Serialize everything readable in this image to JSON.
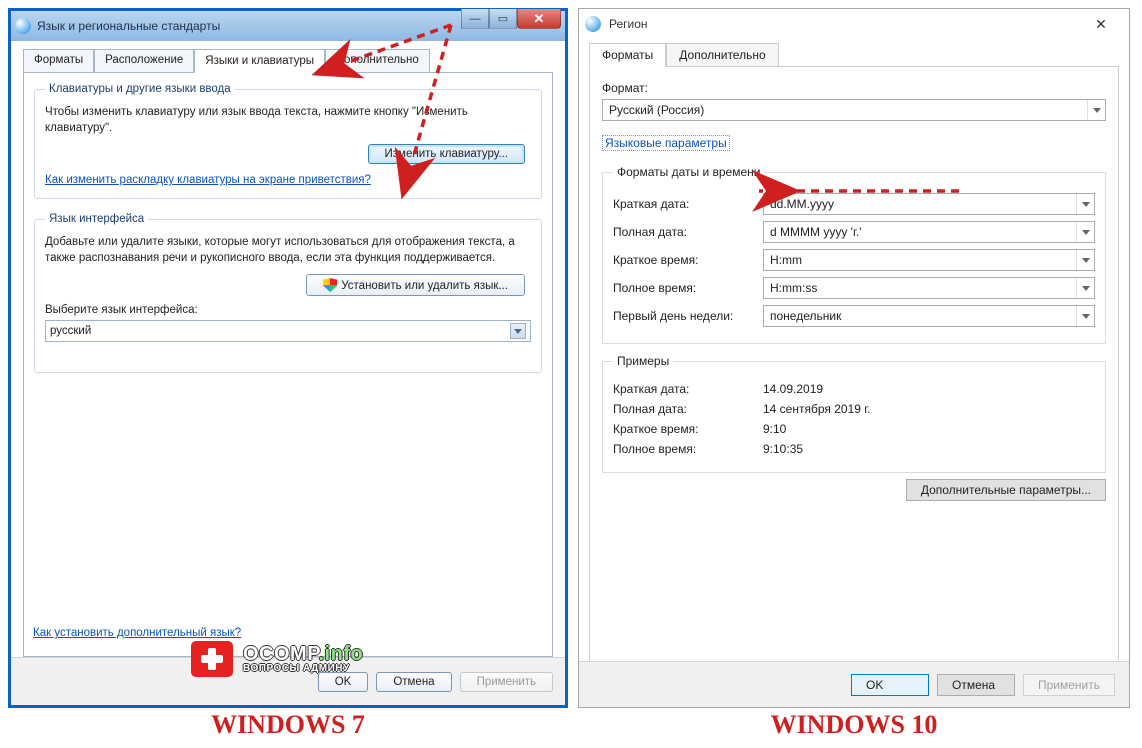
{
  "watermark": {
    "line1a": "OCOMP",
    "line1b": ".info",
    "line2": "ВОПРОСЫ АДМИНУ"
  },
  "captions": {
    "w7": "WINDOWS 7",
    "w10": "WINDOWS 10"
  },
  "w7": {
    "title": "Язык и региональные стандарты",
    "tabs": [
      "Форматы",
      "Расположение",
      "Языки и клавиатуры",
      "Дополнительно"
    ],
    "active_tab": 2,
    "group_keyboards": {
      "legend": "Клавиатуры и другие языки ввода",
      "text": "Чтобы изменить клавиатуру или язык ввода текста, нажмите кнопку \"Изменить клавиатуру\".",
      "button": "Изменить клавиатуру...",
      "link": "Как изменить раскладку клавиатуры на экране приветствия?"
    },
    "group_ui": {
      "legend": "Язык интерфейса",
      "text": "Добавьте или удалите языки, которые могут использоваться для отображения текста, а также распознавания речи и рукописного ввода, если эта функция поддерживается.",
      "button": "Установить или удалить язык...",
      "select_label": "Выберите язык интерфейса:",
      "select_value": "русский"
    },
    "help_link": "Как установить дополнительный язык?",
    "buttons": {
      "ok": "OK",
      "cancel": "Отмена",
      "apply": "Применить"
    }
  },
  "w10": {
    "title": "Регион",
    "tabs": [
      "Форматы",
      "Дополнительно"
    ],
    "active_tab": 0,
    "format_label": "Формат:",
    "format_value": "Русский (Россия)",
    "lang_link": "Языковые параметры",
    "group_dt": {
      "legend": "Форматы даты и времени",
      "short_date_label": "Краткая дата:",
      "short_date_value": "dd.MM.yyyy",
      "long_date_label": "Полная дата:",
      "long_date_value": "d MMMM yyyy 'г.'",
      "short_time_label": "Краткое время:",
      "short_time_value": "H:mm",
      "long_time_label": "Полное время:",
      "long_time_value": "H:mm:ss",
      "first_day_label": "Первый день недели:",
      "first_day_value": "понедельник"
    },
    "group_ex": {
      "legend": "Примеры",
      "short_date_label": "Краткая дата:",
      "short_date_value": "14.09.2019",
      "long_date_label": "Полная дата:",
      "long_date_value": "14 сентября 2019 г.",
      "short_time_label": "Краткое время:",
      "short_time_value": "9:10",
      "long_time_label": "Полное время:",
      "long_time_value": "9:10:35"
    },
    "more_button": "Дополнительные параметры...",
    "buttons": {
      "ok": "OK",
      "cancel": "Отмена",
      "apply": "Применить"
    }
  }
}
